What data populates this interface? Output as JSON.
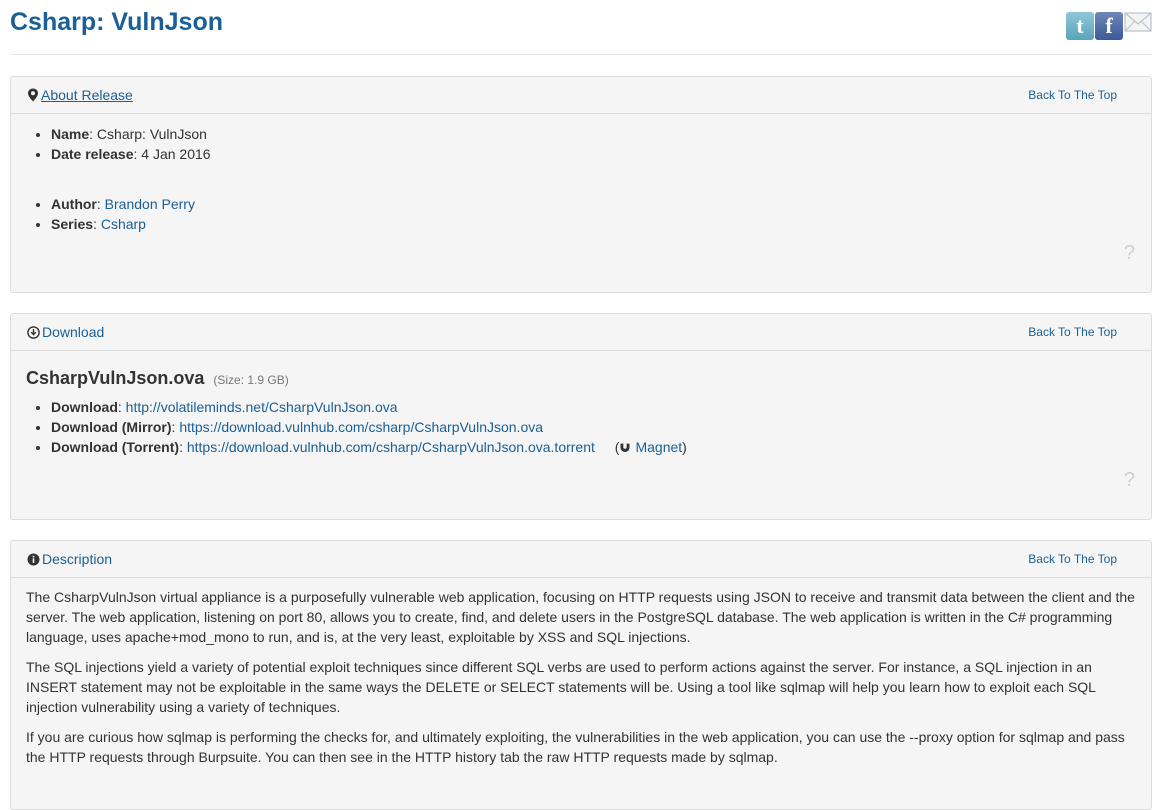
{
  "header": {
    "title": "Csharp: VulnJson",
    "share": {
      "twitter_glyph": "t",
      "facebook_glyph": "f"
    }
  },
  "about": {
    "heading": "About Release",
    "back_top": "Back To The Top",
    "help": "?",
    "name_label": "Name",
    "name_value": "Csharp: VulnJson",
    "date_label": "Date release",
    "date_value": "4 Jan 2016",
    "author_label": "Author",
    "author_value": "Brandon Perry",
    "series_label": "Series",
    "series_value": "Csharp"
  },
  "download": {
    "heading": "Download",
    "back_top": "Back To The Top",
    "help": "?",
    "file_name": "CsharpVulnJson.ova",
    "file_size": "(Size: 1.9 GB)",
    "links": [
      {
        "label": "Download",
        "url": "http://volatileminds.net/CsharpVulnJson.ova"
      },
      {
        "label": "Download (Mirror)",
        "url": "https://download.vulnhub.com/csharp/CsharpVulnJson.ova"
      },
      {
        "label": "Download (Torrent)",
        "url": "https://download.vulnhub.com/csharp/CsharpVulnJson.ova.torrent"
      }
    ],
    "magnet": "Magnet"
  },
  "description": {
    "heading": "Description",
    "back_top": "Back To The Top",
    "paragraphs": [
      "The CsharpVulnJson virtual appliance is a purposefully vulnerable web application, focusing on HTTP requests using JSON to receive and transmit data between the client and the server. The web application, listening on port 80, allows you to create, find, and delete users in the PostgreSQL database. The web application is written in the C# programming language, uses apache+mod_mono to run, and is, at the very least, exploitable by XSS and SQL injections.",
      "The SQL injections yield a variety of potential exploit techniques since different SQL verbs are used to perform actions against the server. For instance, a SQL injection in an INSERT statement may not be exploitable in the same ways the DELETE or SELECT statements will be. Using a tool like sqlmap will help you learn how to exploit each SQL injection vulnerability using a variety of techniques.",
      "If you are curious how sqlmap is performing the checks for, and ultimately exploiting, the vulnerabilities in the web application, you can use the --proxy option for sqlmap and pass the HTTP requests through Burpsuite. You can then see in the HTTP history tab the raw HTTP requests made by sqlmap."
    ]
  },
  "icons": {
    "about": "map-marker-icon",
    "download": "download-circle-icon",
    "description": "info-circle-icon",
    "magnet": "magnet-icon"
  },
  "colors": {
    "link": "#1a5f95",
    "panel_bg": "#f5f5f5",
    "border": "#dddddd"
  }
}
